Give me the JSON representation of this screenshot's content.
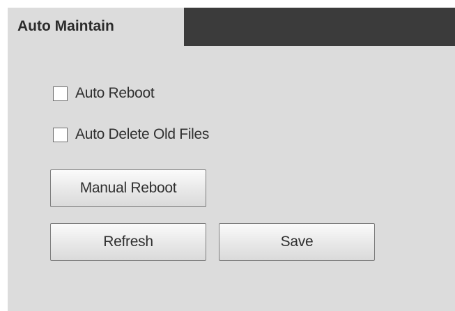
{
  "page": {
    "title": "Auto Maintain"
  },
  "options": {
    "auto_reboot": {
      "label": "Auto Reboot",
      "checked": false
    },
    "auto_delete_old_files": {
      "label": "Auto Delete Old Files",
      "checked": false
    }
  },
  "buttons": {
    "manual_reboot": "Manual Reboot",
    "refresh": "Refresh",
    "save": "Save"
  },
  "colors": {
    "panel_background": "#dcdcdc",
    "header_bar": "#3b3b3b"
  }
}
